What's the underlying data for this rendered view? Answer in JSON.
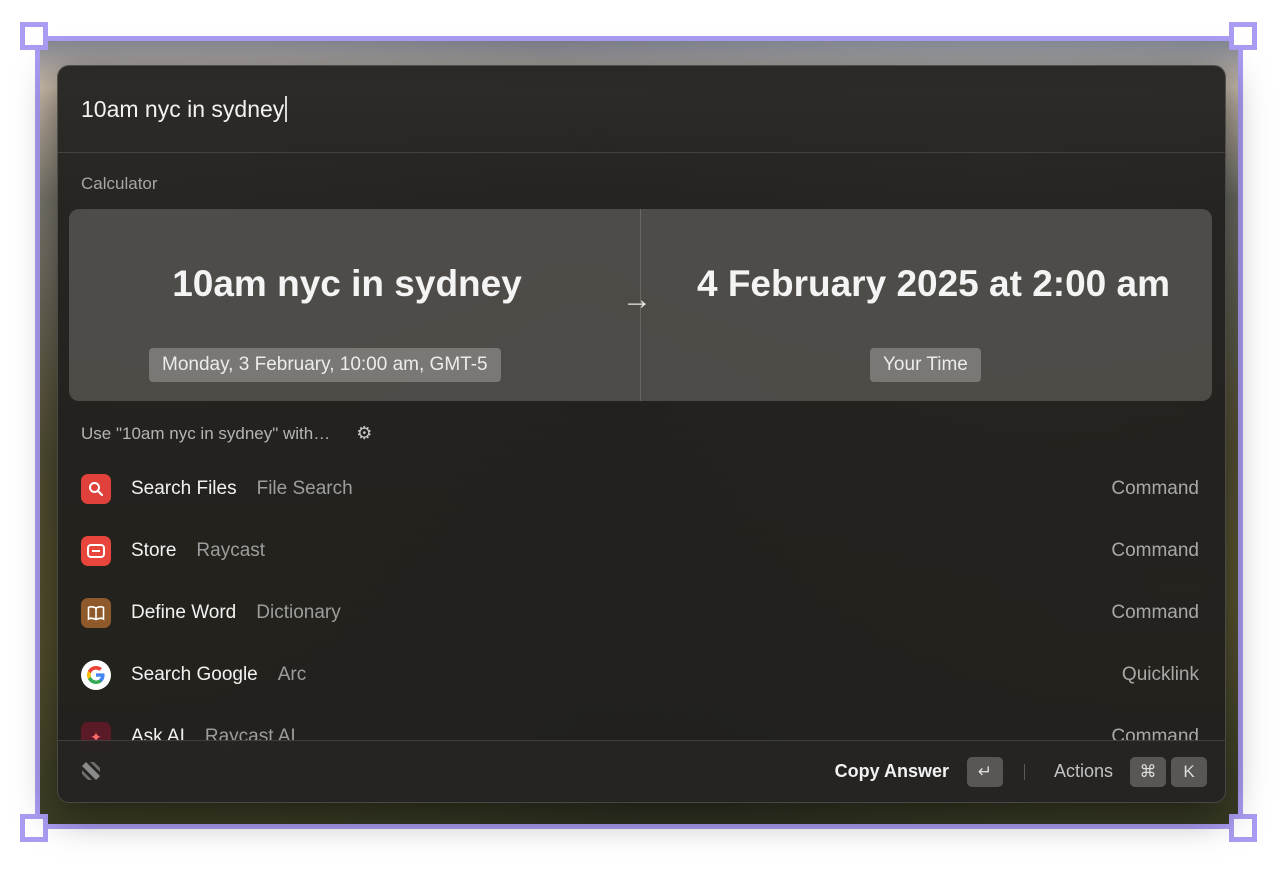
{
  "search": {
    "query": "10am nyc in sydney"
  },
  "calculator": {
    "section_label": "Calculator",
    "query": "10am nyc in sydney",
    "arrow": "→",
    "result": "4 February 2025 at 2:00 am",
    "source_detail": "Monday, 3 February, 10:00 am, GMT-5",
    "result_detail": "Your Time"
  },
  "use_with": {
    "label": "Use \"10am nyc in sydney\" with…",
    "settings_icon": "gear-icon"
  },
  "results": [
    {
      "title": "Search Files",
      "subtitle": "File Search",
      "kind": "Command",
      "icon": "search-files-icon",
      "color": "#e0413a"
    },
    {
      "title": "Store",
      "subtitle": "Raycast",
      "kind": "Command",
      "icon": "store-icon",
      "color": "#e8453c"
    },
    {
      "title": "Define Word",
      "subtitle": "Dictionary",
      "kind": "Command",
      "icon": "dictionary-icon",
      "color": "#8f5a2b"
    },
    {
      "title": "Search Google",
      "subtitle": "Arc",
      "kind": "Quicklink",
      "icon": "google-icon",
      "color": "#ffffff"
    },
    {
      "title": "Ask AI",
      "subtitle": "Raycast AI",
      "kind": "Command",
      "icon": "ask-ai-icon",
      "color": "#5a1a26"
    }
  ],
  "footer": {
    "primary_action": "Copy Answer",
    "enter_key": "↵",
    "actions_label": "Actions",
    "cmd_key": "⌘",
    "k_key": "K"
  }
}
